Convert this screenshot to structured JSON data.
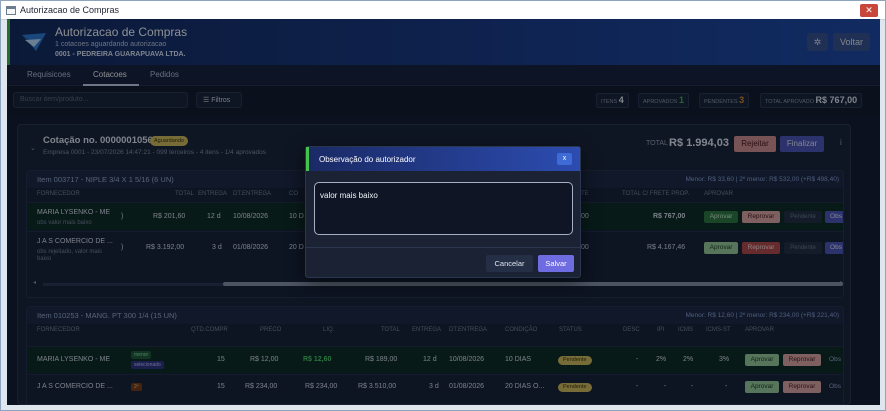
{
  "window": {
    "title": "Autorizacao de Compras",
    "close_label": "✕"
  },
  "header": {
    "title": "Autorizacao de Compras",
    "subtitle": "1 cotacoes aguardando autorizacao",
    "company": "0001 - PEDREIRA GUARAPUAVA LTDA.",
    "gear_icon": "✲",
    "back_label": "Voltar"
  },
  "tabs": [
    {
      "label": "Requisicoes"
    },
    {
      "label": "Cotacoes",
      "active": true
    },
    {
      "label": "Pedidos"
    }
  ],
  "toolbar": {
    "search_placeholder": "Buscar item/produto...",
    "filters_label": "☰ Filtros",
    "stats": [
      {
        "label": "ITENS",
        "value": "4",
        "color": "#e6ebf5"
      },
      {
        "label": "APROVADOS",
        "value": "1",
        "color": "#4caf50"
      },
      {
        "label": "PENDENTES",
        "value": "3",
        "color": "#e08a2e"
      },
      {
        "label": "TOTAL APROVADO",
        "value": "R$ 767,00",
        "color": "#e6ebf5"
      }
    ]
  },
  "cotacao": {
    "title": "Cotação no. 0000001056",
    "status": "Aguardando",
    "meta": "Empresa 0001 - 23/07/2026 14:47:21 - 099 terceiros - 4 itens - 1/4 aprovados",
    "total_label": "TOTAL",
    "total_value": "R$ 1.994,03",
    "reject_label": "Rejeitar",
    "finalize_label": "Finalizar",
    "info_icon": "i",
    "caret": "⌄"
  },
  "item1": {
    "title": "Item 003717 - NIPLE 3/4 X 1 5/16 (6 UN)",
    "menor": "Menor: R$ 33,60 | 2º menor: R$ 532,00 (+R$ 498,40)",
    "columns": {
      "fornecedor": "FORNECEDOR",
      "total": "TOTAL",
      "entrega": "ENTREGA",
      "dt_entrega": "DT.ENTREGA",
      "co": "CO",
      "te": "TE",
      "total_frete": "TOTAL C/ FRETE PROP.",
      "aprovar": "APROVAR"
    },
    "rows": [
      {
        "fornecedor": "MARIA LYSENKO - ME",
        "obs": "obs valor mais baixo",
        "qty_tail": ")",
        "total": "R$ 201,60",
        "entrega": "12 d",
        "dt_entrega": "10/08/2026",
        "cond": "10 D",
        "te": ",00",
        "total_frete": "R$ 767,00",
        "aprovar": "Aprovar",
        "reprovar": "Reprovar",
        "pendente": "Pendente",
        "obs_btn": "Obs"
      },
      {
        "fornecedor": "J A S COMERCIO DE ...",
        "obs": "obs rejeitado, valor mais baixo",
        "qty_tail": ")",
        "total": "R$ 3.192,00",
        "entrega": "3 d",
        "dt_entrega": "01/08/2026",
        "cond": "20 D",
        "te": ",00",
        "total_frete": "R$ 4.167,46",
        "aprovar": "Aprovar",
        "reprovar": "Reprovar",
        "pendente": "Pendente",
        "obs_btn": "Obs"
      }
    ]
  },
  "item2": {
    "title": "Item 010253 - MANG. PT 300 1/4 (15 UN)",
    "menor": "Menor: R$ 12,60 | 2º menor: R$ 234,00 (+R$ 221,40)",
    "columns": {
      "fornecedor": "FORNECEDOR",
      "qtd": "QTD.COMPR",
      "preco": "PRECO",
      "liq": "LIQ.",
      "total": "TOTAL",
      "entrega": "ENTREGA",
      "dt_entrega": "DT.ENTREGA",
      "condicao": "CONDIÇÃO",
      "status": "STATUS",
      "desc": "DESC",
      "ipi": "IPI",
      "icms": "ICMS",
      "icms_st": "ICMS-ST",
      "aprovar": "APROVAR"
    },
    "rows": [
      {
        "fornecedor": "MARIA LYSENKO - ME",
        "tags": [
          "menor",
          "selecionado"
        ],
        "qtd": "15",
        "preco": "R$ 12,00",
        "liq": "R$ 12,60",
        "total": "R$ 189,00",
        "entrega": "12 d",
        "dt_entrega": "10/08/2026",
        "condicao": "10 DIAS",
        "status": "Pendente",
        "desc": "-",
        "ipi": "2%",
        "icms": "2%",
        "icms_st": "3%",
        "aprovar": "Aprovar",
        "reprovar": "Reprovar",
        "obs_btn": "Obs"
      },
      {
        "fornecedor": "J A S COMERCIO DE ...",
        "tags": [
          "2º"
        ],
        "qtd": "15",
        "preco": "R$ 234,00",
        "liq": "R$ 234,00",
        "total": "R$ 3.510,00",
        "entrega": "3 d",
        "dt_entrega": "01/08/2026",
        "condicao": "20 DIAS O...",
        "status": "Pendente",
        "desc": "-",
        "ipi": "-",
        "icms": "-",
        "icms_st": "-",
        "aprovar": "Aprovar",
        "reprovar": "Reprovar",
        "obs_btn": "Obs"
      }
    ]
  },
  "modal": {
    "title": "Observação do autorizador",
    "close_label": "x",
    "text": "valor mais baixo",
    "cancel_label": "Cancelar",
    "save_label": "Salvar"
  }
}
